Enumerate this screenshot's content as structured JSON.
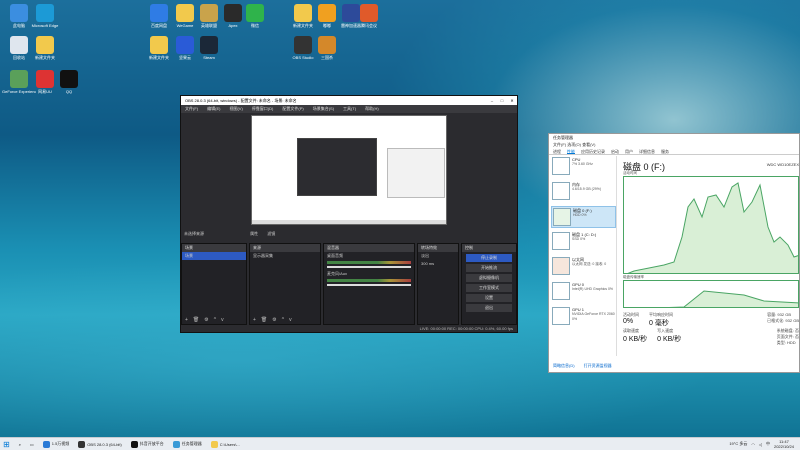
{
  "desktop_icons": [
    {
      "label": "此电脑",
      "color": "#3b8ee0"
    },
    {
      "label": "Microsoft Edge",
      "color": "#1c9ad6"
    },
    {
      "label": "回收站",
      "color": "#dfe6ee"
    },
    {
      "label": "新建文件夹",
      "color": "#f2c94c"
    },
    {
      "label": "GeForce Experience",
      "color": "#5aa05a"
    },
    {
      "label": "网易UU",
      "color": "#d33"
    },
    {
      "label": "QQ",
      "color": "#111"
    },
    {
      "label": "百度网盘",
      "color": "#2f7ce5"
    },
    {
      "label": "WeGame",
      "color": "#f2c94c"
    },
    {
      "label": "英雄联盟",
      "color": "#c9a34b"
    },
    {
      "label": "Apex",
      "color": "#2a2a2a"
    },
    {
      "label": "微信",
      "color": "#2fb34b"
    },
    {
      "label": "新建文件夹",
      "color": "#f2c94c"
    },
    {
      "label": "坚果云",
      "color": "#2a5bd7"
    },
    {
      "label": "Steam",
      "color": "#1b2838"
    },
    {
      "label": "新建文件夹",
      "color": "#f2c94c"
    },
    {
      "label": "嘟嘟",
      "color": "#f0a020"
    },
    {
      "label": "雷神加速器",
      "color": "#2d4a9a"
    },
    {
      "label": "腾讯会议",
      "color": "#e05a2a"
    },
    {
      "label": "OBS Studio",
      "color": "#333"
    },
    {
      "label": "三国杀",
      "color": "#d4882a"
    }
  ],
  "obs": {
    "title": "OBS 28.0.3 (64-bit, windows) - 配置文件: 未命名 - 场景: 未命名",
    "menu": [
      "文件(F)",
      "编辑(E)",
      "视图(V)",
      "停靠窗口(D)",
      "配置文件(P)",
      "场景集合(S)",
      "工具(T)",
      "帮助(H)"
    ],
    "scene_bar": "未选择来源",
    "scene_bar_btn1": "属性",
    "scene_bar_btn2": "滤镜",
    "docks": {
      "scenes": {
        "title": "场景",
        "items": [
          "场景"
        ]
      },
      "sources": {
        "title": "来源",
        "items": [
          "显示器采集"
        ]
      },
      "mixer": {
        "title": "混音器",
        "ch1": "桌面音频",
        "ch1_db": "0.0 dB",
        "ch2": "麦克风/Aux",
        "ch2_db": "0.0 dB"
      },
      "transitions": {
        "title": "转场特效",
        "type": "淡出",
        "duration_label": "时长",
        "duration": "300 ms"
      },
      "controls": {
        "title": "控制",
        "buttons": [
          "停止录制",
          "开始推流",
          "虚拟摄像机",
          "工作室模式",
          "设置",
          "退出"
        ]
      }
    },
    "status": "LIVE: 00:00:00   REC: 00:00:00   CPU: 0.4%, 60.00 fps"
  },
  "taskmgr": {
    "title": "任务管理器",
    "menu": "文件(F)  选项(O)  查看(V)",
    "tabs": [
      "进程",
      "性能",
      "应用历史记录",
      "启动",
      "用户",
      "详细信息",
      "服务"
    ],
    "active_tab": "性能",
    "left": [
      {
        "name": "CPU",
        "sub": "7% 3.60 GHz"
      },
      {
        "name": "内存",
        "sub": "4.6/15.9 GB (29%)"
      },
      {
        "name": "磁盘 0 (F:)",
        "sub": "HDD 0%"
      },
      {
        "name": "磁盘 1 (C: D:)",
        "sub": "SSD 0%"
      },
      {
        "name": "以太网",
        "sub": "以太网 发送: 0 接收: 0"
      },
      {
        "name": "GPU 0",
        "sub": "Intel(R) UHD Graphics 0%"
      },
      {
        "name": "GPU 1",
        "sub": "NVIDIA GeForce RTX 2060 0%"
      }
    ],
    "heading": "磁盘 0 (F:)",
    "model": "WDC WD10EZEX",
    "graph_label": "活动时间",
    "graph_label2": "磁盘传输速率",
    "stats": {
      "active_label": "活动时间",
      "active": "0%",
      "resp_label": "平均响应时间",
      "resp": "0 毫秒",
      "read_label": "读取速度",
      "read": "0 KB/秒",
      "write_label": "写入速度",
      "write": "0 KB/秒",
      "cap_label": "容量:",
      "cap": "932 GB",
      "fmt_label": "已格式化:",
      "fmt": "932 GB",
      "sys_label": "系统磁盘:",
      "sys": "否",
      "page_label": "页面文件:",
      "page": "否",
      "type_label": "类型:",
      "type": "HDD"
    },
    "footer1": "简略信息(D)",
    "footer2": "打开资源监视器"
  },
  "taskbar": {
    "items": [
      {
        "label": "1.5万视频",
        "color": "#2a7ad6"
      },
      {
        "label": "OBS 28.0.3 (64-bit)",
        "color": "#333"
      },
      {
        "label": "抖音开放平台",
        "color": "#111"
      },
      {
        "label": "任务管理器",
        "color": "#3a9ad6"
      },
      {
        "label": "C:\\Users\\...",
        "color": "#f2c94c"
      }
    ],
    "weather": "19°C 多云",
    "lang": "中",
    "time": "11:47",
    "date": "2022/10/24"
  }
}
